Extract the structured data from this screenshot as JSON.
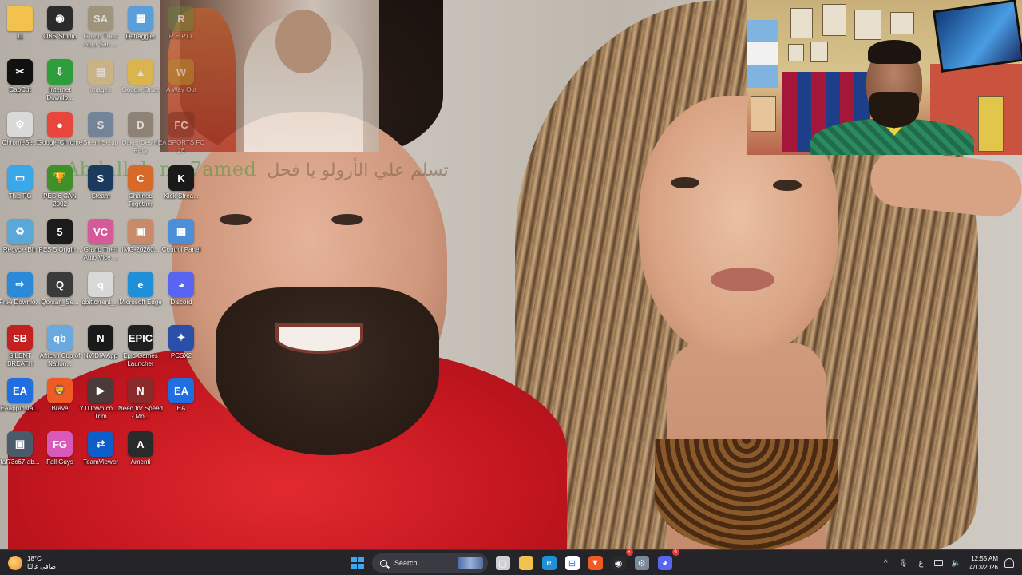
{
  "overlay_text": {
    "arabic": "تسلم علي الأرولو يا فحل",
    "name": "Abdallah mo7amed"
  },
  "desktop_icons": [
    {
      "label": "11",
      "icon": "folder-icon",
      "color": "#f2c14e",
      "glyph": "",
      "faded": false
    },
    {
      "label": "OBS Studio",
      "icon": "obs-icon",
      "color": "#2b2b2b",
      "glyph": "◉",
      "faded": false
    },
    {
      "label": "Grand Theft Auto San ...",
      "icon": "gta-san-andreas-icon",
      "color": "#8a7a55",
      "glyph": "SA",
      "faded": true
    },
    {
      "label": "Defraggler",
      "icon": "defraggler-icon",
      "color": "#5c9fd8",
      "glyph": "▦",
      "faded": false
    },
    {
      "label": "R.E.P.O.",
      "icon": "repo-game-icon",
      "color": "#6b7d3a",
      "glyph": "R",
      "faded": true
    },
    {
      "label": "CapCut",
      "icon": "capcut-icon",
      "color": "#111111",
      "glyph": "✂",
      "faded": false
    },
    {
      "label": "Internet Downlo...",
      "icon": "internet-download-manager-icon",
      "color": "#2e9d3c",
      "glyph": "⇩",
      "faded": false
    },
    {
      "label": "images",
      "icon": "images-folder-icon",
      "color": "#d8b26a",
      "glyph": "▤",
      "faded": true
    },
    {
      "label": "Google Drive",
      "icon": "google-drive-icon",
      "color": "#f5b400",
      "glyph": "▲",
      "faded": true
    },
    {
      "label": "A Way Out",
      "icon": "a-way-out-icon",
      "color": "#b38a2a",
      "glyph": "W",
      "faded": true
    },
    {
      "label": "ChromeSe...",
      "icon": "chrome-setup-icon",
      "color": "#d9d9d9",
      "glyph": "⚙",
      "faded": false
    },
    {
      "label": "Google Chrome",
      "icon": "chrome-icon",
      "color": "#e8453c",
      "glyph": "●",
      "faded": false
    },
    {
      "label": "SteamSetup",
      "icon": "steam-setup-icon",
      "color": "#3a5f8a",
      "glyph": "S",
      "faded": true
    },
    {
      "label": "Dakar Desert Rally",
      "icon": "dakar-rally-icon",
      "color": "#6b5a4a",
      "glyph": "D",
      "faded": true
    },
    {
      "label": "EA SPORTS FC 26",
      "icon": "ea-fc26-icon",
      "color": "#7a3020",
      "glyph": "FC",
      "faded": true
    },
    {
      "label": "This PC",
      "icon": "this-pc-icon",
      "color": "#3aa7e8",
      "glyph": "▭",
      "faded": false
    },
    {
      "label": "PES 6 CAN 2002",
      "icon": "pes6-icon",
      "color": "#3f8f2a",
      "glyph": "🏆",
      "faded": false
    },
    {
      "label": "Steam",
      "icon": "steam-icon",
      "color": "#1b3a5e",
      "glyph": "S",
      "faded": false
    },
    {
      "label": "Chained Together",
      "icon": "chained-together-icon",
      "color": "#d66a2a",
      "glyph": "C",
      "faded": false
    },
    {
      "label": "Kick-Strea...",
      "icon": "kick-icon",
      "color": "#1a1a1a",
      "glyph": "K",
      "faded": false
    },
    {
      "label": "Recycle Bin",
      "icon": "recycle-bin-icon",
      "color": "#5aa8d8",
      "glyph": "♻",
      "faded": false
    },
    {
      "label": "PES 5 Origin...",
      "icon": "pes5-icon",
      "color": "#1b1b1b",
      "glyph": "5",
      "faded": false
    },
    {
      "label": "Grand Theft Auto Vice ...",
      "icon": "gta-vice-city-icon",
      "color": "#d65a9a",
      "glyph": "VC",
      "faded": false
    },
    {
      "label": "IMG-20260...",
      "icon": "image-file-icon",
      "color": "#c98a6a",
      "glyph": "▣",
      "faded": false
    },
    {
      "label": "Control Panel",
      "icon": "control-panel-icon",
      "color": "#4a8fd8",
      "glyph": "▦",
      "faded": false
    },
    {
      "label": "Free Downlo...",
      "icon": "free-download-manager-icon",
      "color": "#2a8ad8",
      "glyph": "⇨",
      "faded": false
    },
    {
      "label": "Qorsan_Se...",
      "icon": "qorsan-icon",
      "color": "#3a3a3a",
      "glyph": "Q",
      "faded": false
    },
    {
      "label": "qbittorrent_...",
      "icon": "qbittorrent-setup-icon",
      "color": "#d8d8d8",
      "glyph": "q",
      "faded": false
    },
    {
      "label": "Microsoft Edge",
      "icon": "edge-icon",
      "color": "#1f8fd8",
      "glyph": "e",
      "faded": false
    },
    {
      "label": "Discord",
      "icon": "discord-icon",
      "color": "#5865f2",
      "glyph": "◕",
      "faded": false
    },
    {
      "label": "SILENT BREATH",
      "icon": "silent-breath-icon",
      "color": "#c42020",
      "glyph": "SB",
      "faded": false
    },
    {
      "label": "African Cup of Nation...",
      "icon": "qbittorrent-icon",
      "color": "#6aa8e0",
      "glyph": "qb",
      "faded": false
    },
    {
      "label": "NVIDIA App",
      "icon": "nvidia-icon",
      "color": "#1a1a1a",
      "glyph": "N",
      "faded": false
    },
    {
      "label": "Epic Games Launcher",
      "icon": "epic-games-icon",
      "color": "#202020",
      "glyph": "EPIC",
      "faded": false
    },
    {
      "label": "PCSX2",
      "icon": "pcsx2-icon",
      "color": "#2a4fa8",
      "glyph": "✦",
      "faded": false
    },
    {
      "label": "EAappInstal...",
      "icon": "ea-app-installer-icon",
      "color": "#1f6fe0",
      "glyph": "EA",
      "faded": false
    },
    {
      "label": "Brave",
      "icon": "brave-icon",
      "color": "#f05a24",
      "glyph": "🦁",
      "faded": false
    },
    {
      "label": "YTDown.co... - Trim",
      "icon": "video-file-icon",
      "color": "#4a3a3a",
      "glyph": "▶",
      "faded": false
    },
    {
      "label": "Need for Speed - Mo...",
      "icon": "need-for-speed-icon",
      "color": "#8a2a2a",
      "glyph": "N",
      "faded": false
    },
    {
      "label": "EA",
      "icon": "ea-icon",
      "color": "#1f6fe0",
      "glyph": "EA",
      "faded": false
    },
    {
      "label": "faf73c67-ab...",
      "icon": "image-file-icon",
      "color": "#4a5a6a",
      "glyph": "▣",
      "faded": false
    },
    {
      "label": "Fall Guys",
      "icon": "fall-guys-icon",
      "color": "#d85ab8",
      "glyph": "FG",
      "faded": false
    },
    {
      "label": "TeamViewer",
      "icon": "teamviewer-icon",
      "color": "#0e5ec9",
      "glyph": "⇄",
      "faded": false
    },
    {
      "label": "Amenti",
      "icon": "amenti-icon",
      "color": "#2a2a2a",
      "glyph": "A",
      "faded": false
    }
  ],
  "taskbar": {
    "weather": {
      "temp": "18°C",
      "condition": "صافي غالبًا",
      "icon": "weather-sun-icon"
    },
    "search_placeholder": "Search",
    "pinned": [
      {
        "name": "task-view",
        "icon": "task-view-icon",
        "color": "#d0d0d0",
        "glyph": "▢",
        "badge": ""
      },
      {
        "name": "file-explorer",
        "icon": "file-explorer-icon",
        "color": "#f2c14e",
        "glyph": "",
        "badge": ""
      },
      {
        "name": "edge",
        "icon": "edge-icon",
        "color": "#1f8fd8",
        "glyph": "e",
        "badge": ""
      },
      {
        "name": "microsoft-store",
        "icon": "store-icon",
        "color": "#ffffff",
        "glyph": "⊞",
        "badge": ""
      },
      {
        "name": "brave",
        "icon": "brave-icon",
        "color": "#f05a24",
        "glyph": "▼",
        "badge": ""
      },
      {
        "name": "obs",
        "icon": "obs-icon",
        "color": "#2b2b2b",
        "glyph": "◉",
        "badge": "•"
      },
      {
        "name": "settings",
        "icon": "settings-gear-icon",
        "color": "#7a8a9a",
        "glyph": "⚙",
        "badge": ""
      },
      {
        "name": "discord",
        "icon": "discord-icon",
        "color": "#5865f2",
        "glyph": "◕",
        "badge": "9"
      }
    ],
    "tray": {
      "chevron": "^",
      "mic": "🎙",
      "language": "ع",
      "time": "12:55 AM",
      "date": "4/13/2026"
    }
  }
}
